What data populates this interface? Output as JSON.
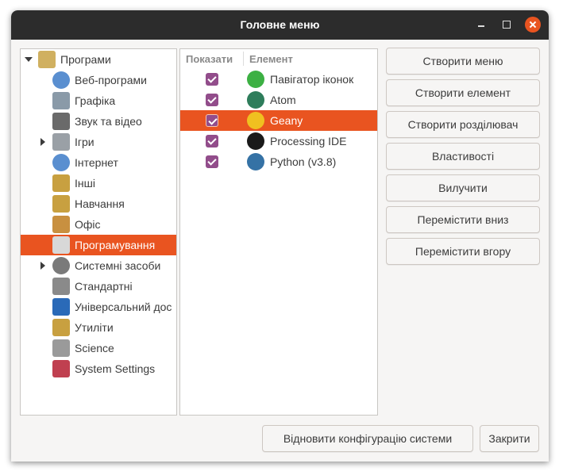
{
  "window": {
    "title": "Головне меню"
  },
  "tree": {
    "items": [
      {
        "label": "Програми",
        "icon": "programs-icon",
        "color": "#d0b060"
      },
      {
        "label": "Веб-програми",
        "icon": "globe-icon",
        "color": "#5a8fd0"
      },
      {
        "label": "Графіка",
        "icon": "image-icon",
        "color": "#8a9aa8"
      },
      {
        "label": "Звук та відео",
        "icon": "film-icon",
        "color": "#6a6a6a"
      },
      {
        "label": "Ігри",
        "icon": "gamepad-icon",
        "color": "#9aa0a6"
      },
      {
        "label": "Інтернет",
        "icon": "globe-icon",
        "color": "#5a8fd0"
      },
      {
        "label": "Інші",
        "icon": "misc-icon",
        "color": "#c8a040"
      },
      {
        "label": "Навчання",
        "icon": "education-icon",
        "color": "#c8a040"
      },
      {
        "label": "Офіс",
        "icon": "office-icon",
        "color": "#c89040"
      },
      {
        "label": "Програмування",
        "icon": "programming-icon",
        "color": "#b0b0b0"
      },
      {
        "label": "Системні засоби",
        "icon": "system-icon",
        "color": "#7a7a7a"
      },
      {
        "label": "Стандартні",
        "icon": "accessories-icon",
        "color": "#8a8a8a"
      },
      {
        "label": "Універсальний дос",
        "icon": "accessibility-icon",
        "color": "#2a6ab8"
      },
      {
        "label": "Утиліти",
        "icon": "utilities-icon",
        "color": "#c8a040"
      },
      {
        "label": "Science",
        "icon": "flask-icon",
        "color": "#9a9a9a"
      },
      {
        "label": "System Settings",
        "icon": "settings-icon",
        "color": "#c04050"
      }
    ]
  },
  "items": {
    "header_show": "Показати",
    "header_element": "Елемент",
    "rows": [
      {
        "label": "Павігатор іконок",
        "icon": "icon-browser-icon",
        "color": "#3cb043"
      },
      {
        "label": "Atom",
        "icon": "atom-icon",
        "color": "#2e7d5b"
      },
      {
        "label": "Geany",
        "icon": "geany-icon",
        "color": "#f0c020"
      },
      {
        "label": "Processing IDE",
        "icon": "processing-icon",
        "color": "#1a1a1a"
      },
      {
        "label": "Python (v3.8)",
        "icon": "python-icon",
        "color": "#3572a5"
      }
    ]
  },
  "buttons": {
    "create_menu": "Створити меню",
    "create_element": "Створити елемент",
    "create_separator": "Створити розділювач",
    "properties": "Властивості",
    "delete": "Вилучити",
    "move_down": "Перемістити вниз",
    "move_up": "Перемістити вгору",
    "restore": "Відновити конфігурацію системи",
    "close": "Закрити"
  },
  "colors": {
    "accent": "#e95420",
    "check": "#924d8b",
    "titlebar": "#2c2c2c"
  }
}
